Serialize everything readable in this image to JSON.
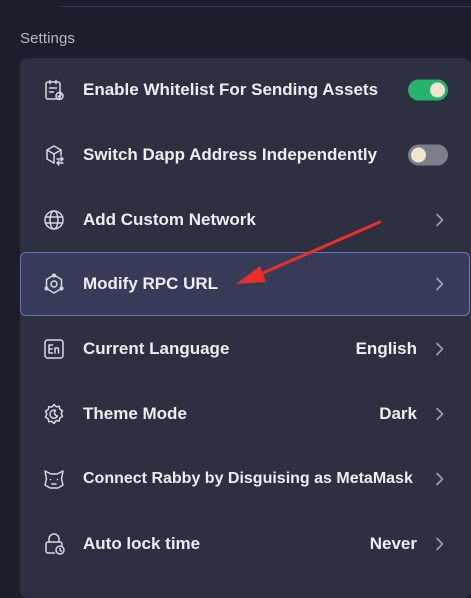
{
  "section": {
    "title": "Settings"
  },
  "items": [
    {
      "label": "Enable Whitelist For Sending Assets",
      "icon": "whitelist-clipboard-icon",
      "control": "toggle",
      "toggle_on": true
    },
    {
      "label": "Switch Dapp Address Independently",
      "icon": "cube-switch-icon",
      "control": "toggle",
      "toggle_on": false
    },
    {
      "label": "Add Custom Network",
      "icon": "globe-icon",
      "control": "chevron"
    },
    {
      "label": "Modify RPC URL",
      "icon": "rpc-node-icon",
      "control": "chevron",
      "highlighted": true
    },
    {
      "label": "Current Language",
      "icon": "language-en-icon",
      "control": "chevron",
      "value": "English"
    },
    {
      "label": "Theme Mode",
      "icon": "theme-gear-icon",
      "control": "chevron",
      "value": "Dark"
    },
    {
      "label": "Connect Rabby by Disguising as MetaMask",
      "icon": "fox-mask-icon",
      "control": "chevron"
    },
    {
      "label": "Auto lock time",
      "icon": "lock-clock-icon",
      "control": "chevron",
      "value": "Never"
    }
  ],
  "annotation": {
    "icon": "red-arrow-pointer",
    "color": "#e8302a"
  },
  "colors": {
    "background": "#1c1f2b",
    "card": "#2c3040",
    "highlight": "#373b58",
    "highlight_border": "#6a72c8",
    "toggle_on": "#27b36b",
    "toggle_off": "#7c7f89"
  }
}
